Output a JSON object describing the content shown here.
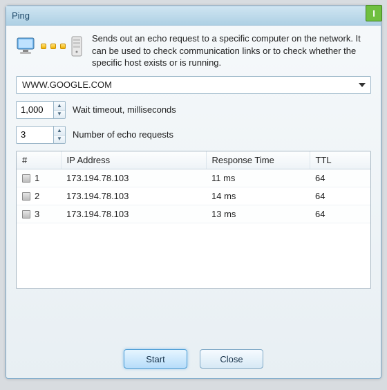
{
  "window": {
    "title": "Ping",
    "corner_marker": "I"
  },
  "description": "Sends out an echo request to a specific computer on the network. It can be used to check communication links or to check whether the specific host exists or is running.",
  "host_input": {
    "value": "WWW.GOOGLE.COM"
  },
  "timeout": {
    "value": "1,000",
    "label": "Wait timeout, milliseconds"
  },
  "count": {
    "value": "3",
    "label": "Number of echo requests"
  },
  "table": {
    "headers": {
      "num": "#",
      "ip": "IP Address",
      "rt": "Response Time",
      "ttl": "TTL"
    },
    "rows": [
      {
        "num": "1",
        "ip": "173.194.78.103",
        "rt": "11 ms",
        "ttl": "64"
      },
      {
        "num": "2",
        "ip": "173.194.78.103",
        "rt": "14 ms",
        "ttl": "64"
      },
      {
        "num": "3",
        "ip": "173.194.78.103",
        "rt": "13 ms",
        "ttl": "64"
      }
    ]
  },
  "buttons": {
    "start": "Start",
    "close": "Close"
  }
}
